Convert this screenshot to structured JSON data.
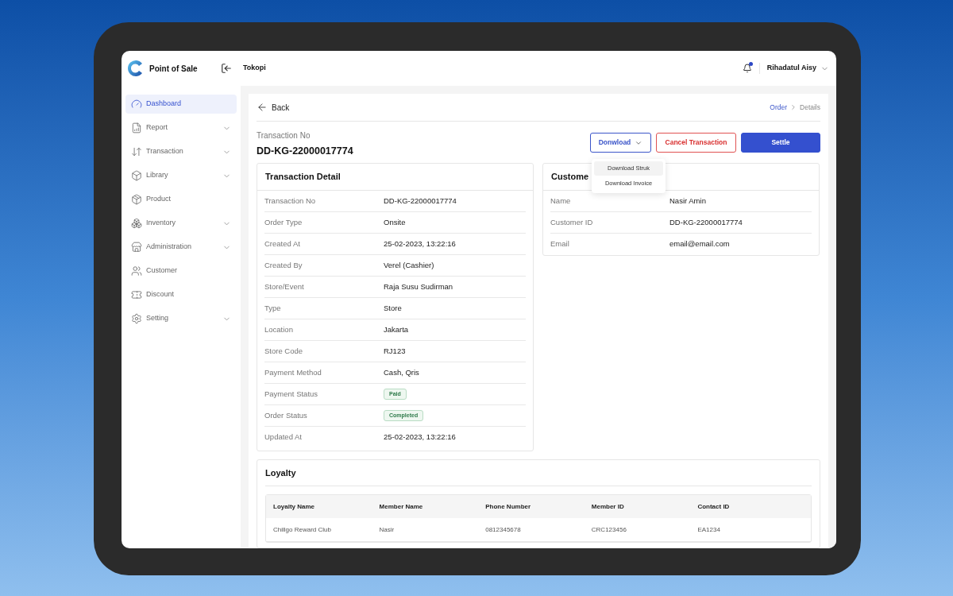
{
  "header": {
    "app_name": "Point of Sale",
    "store": "Tokopi",
    "notification_unread": true,
    "user": "Rihadatul Aisy"
  },
  "sidebar": {
    "items": [
      {
        "label": "Dashboard",
        "expandable": false,
        "selected": true
      },
      {
        "label": "Report",
        "expandable": true,
        "selected": false
      },
      {
        "label": "Transaction",
        "expandable": true,
        "selected": false
      },
      {
        "label": "Library",
        "expandable": true,
        "selected": false
      },
      {
        "label": "Product",
        "expandable": false,
        "selected": false
      },
      {
        "label": "Inventory",
        "expandable": true,
        "selected": false
      },
      {
        "label": "Administration",
        "expandable": true,
        "selected": false
      },
      {
        "label": "Customer",
        "expandable": false,
        "selected": false
      },
      {
        "label": "Discount",
        "expandable": false,
        "selected": false
      },
      {
        "label": "Setting",
        "expandable": true,
        "selected": false
      }
    ]
  },
  "page": {
    "back": "Back",
    "breadcrumb": [
      {
        "label": "Order",
        "selected": false
      },
      {
        "label": "Details",
        "selected": true
      }
    ],
    "id_label": "Transaction No",
    "id_value": "DD-KG-22000017774",
    "buttons": [
      {
        "label": "Donwload",
        "kind": "dropdown"
      },
      {
        "label": "Cancel Transaction",
        "kind": "danger"
      },
      {
        "label": "Settle",
        "kind": "primary"
      }
    ],
    "download_menu": [
      {
        "label": "Download Struk",
        "selected": true
      },
      {
        "label": "Download Invoice",
        "selected": false
      }
    ]
  },
  "transaction_detail": {
    "title": "Transaction Detail",
    "rows": [
      {
        "label": "Transaction No",
        "value": "DD-KG-22000017774",
        "kind": "text"
      },
      {
        "label": "Order Type",
        "value": "Onsite",
        "kind": "text"
      },
      {
        "label": "Created At",
        "value": "25-02-2023, 13:22:16",
        "kind": "text"
      },
      {
        "label": "Created By",
        "value": "Verel (Cashier)",
        "kind": "text"
      },
      {
        "label": "Store/Event",
        "value": "Raja Susu Sudirman",
        "kind": "text"
      },
      {
        "label": "Type",
        "value": "Store",
        "kind": "text"
      },
      {
        "label": "Location",
        "value": "Jakarta",
        "kind": "text"
      },
      {
        "label": "Store Code",
        "value": "RJ123",
        "kind": "text"
      },
      {
        "label": "Payment Method",
        "value": "Cash, Qris",
        "kind": "text"
      },
      {
        "label": "Payment Status",
        "value": "Paid",
        "kind": "badge"
      },
      {
        "label": "Order Status",
        "value": "Completed",
        "kind": "badge"
      },
      {
        "label": "Updated At",
        "value": "25-02-2023, 13:22:16",
        "kind": "text"
      }
    ]
  },
  "customer": {
    "title": "Custome",
    "rows": [
      {
        "label": "Name",
        "value": "Nasir Amin"
      },
      {
        "label": "Customer ID",
        "value": "DD-KG-22000017774"
      },
      {
        "label": "Email",
        "value": "email@email.com"
      }
    ]
  },
  "loyalty": {
    "title": "Loyalty",
    "columns": [
      "Loyalty Name",
      "Member Name",
      "Phone Number",
      "Member ID",
      "Contact ID"
    ],
    "rows": [
      [
        "Chillgo Reward Club",
        "Nasir",
        "0812345678",
        "CRC123456",
        "EA1234"
      ]
    ]
  }
}
